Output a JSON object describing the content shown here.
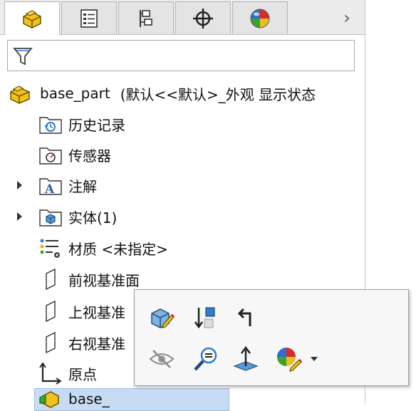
{
  "tabs": [
    {
      "name": "featuremanager-tab",
      "icon": "part-icon",
      "active": true
    },
    {
      "name": "propertymanager-tab",
      "icon": "property-list-icon",
      "active": false
    },
    {
      "name": "configurationmanager-tab",
      "icon": "configuration-icon",
      "active": false
    },
    {
      "name": "dimxpertmanager-tab",
      "icon": "crosshair-icon",
      "active": false
    },
    {
      "name": "displaymanager-tab",
      "icon": "appearance-ball-icon",
      "active": false
    }
  ],
  "tabs_more": "›",
  "tree": {
    "root": {
      "label": "base_part",
      "config": "(默认<<默认>_外观 显示状态"
    },
    "items": [
      {
        "label": "历史记录",
        "icon": "history-folder-icon"
      },
      {
        "label": "传感器",
        "icon": "sensor-folder-icon"
      },
      {
        "label": "注解",
        "icon": "annotation-folder-icon",
        "expandable": true
      },
      {
        "label": "实体(1)",
        "icon": "solid-bodies-folder-icon",
        "expandable": true
      },
      {
        "label": "材质 <未指定>",
        "icon": "material-icon"
      },
      {
        "label": "前视基准面",
        "icon": "plane-icon"
      },
      {
        "label": "上视基准",
        "icon": "plane-icon"
      },
      {
        "label": "右视基准",
        "icon": "plane-icon"
      },
      {
        "label": "原点",
        "icon": "origin-icon"
      }
    ],
    "selected_partial": "base_"
  },
  "context_toolbar": {
    "buttons": [
      "edit-feature-icon",
      "rollback-icon",
      "parent-child-icon",
      "hide-icon",
      "zoom-to-selection-icon",
      "normal-to-icon",
      "appearance-icon",
      "dropdown-arrow-icon"
    ]
  },
  "colors": {
    "tab_bg": "#e4e4e4",
    "selection": "#c7dcf2",
    "accent_yellow": "#f2c21a",
    "accent_blue": "#2f7cc9"
  }
}
